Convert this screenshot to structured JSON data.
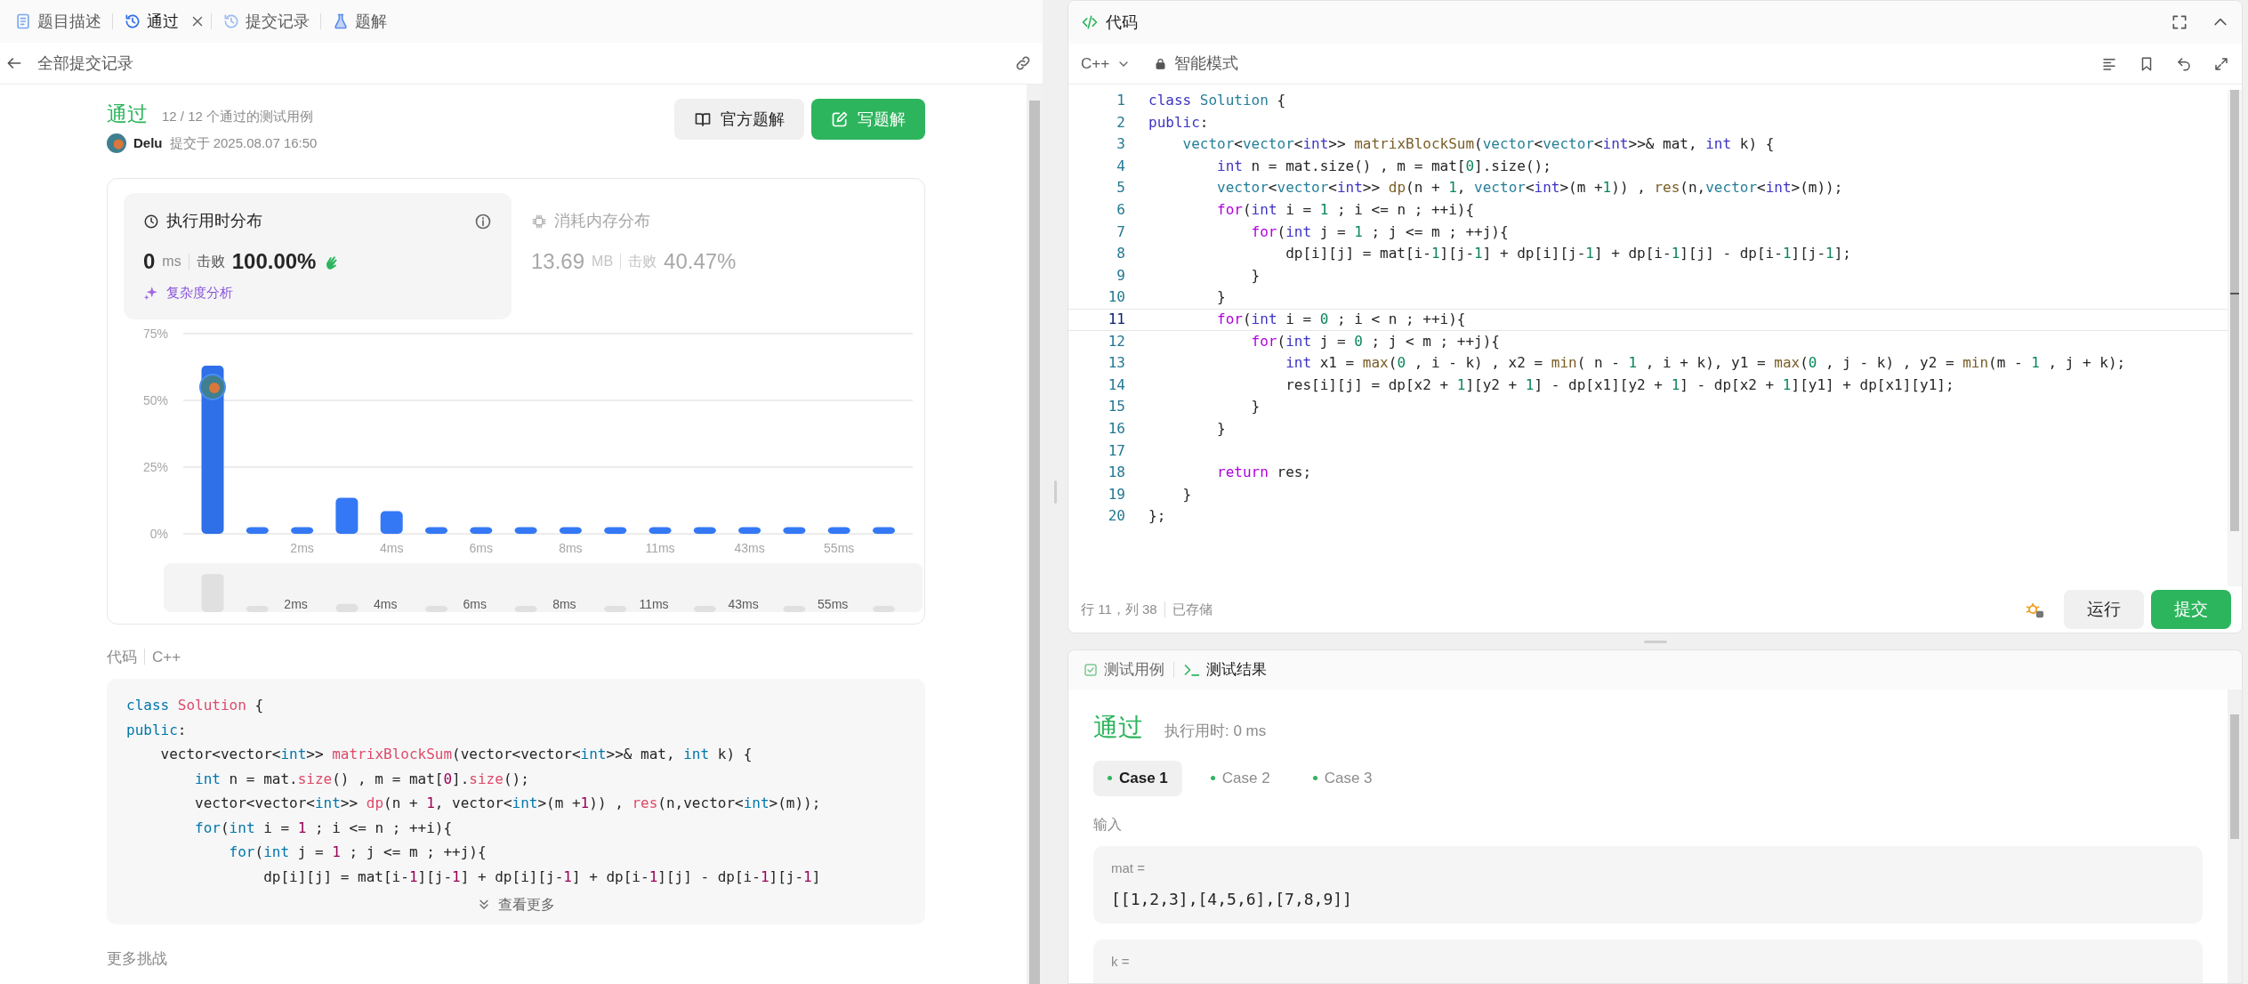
{
  "left_tabs": [
    {
      "label": "题目描述",
      "selected": false,
      "closable": false
    },
    {
      "label": "通过",
      "selected": true,
      "closable": true
    },
    {
      "label": "提交记录",
      "selected": false,
      "closable": false
    },
    {
      "label": "题解",
      "selected": false,
      "closable": false
    }
  ],
  "back_bar": {
    "title": "全部提交记录"
  },
  "submission": {
    "status": "通过",
    "cases": "12 / 12 个通过的测试用例",
    "user": "Delu",
    "submitted": "提交于 2025.08.07 16:50",
    "buttons": [
      {
        "label": "官方题解",
        "kind": "secondary"
      },
      {
        "label": "写题解",
        "kind": "primary"
      }
    ]
  },
  "stats": [
    {
      "title": "执行用时分布",
      "selected": true,
      "value": "0",
      "unit": "ms",
      "beats_label": "击败",
      "beats": "100.00%",
      "link": "复杂度分析"
    },
    {
      "title": "消耗内存分布",
      "selected": false,
      "value": "13.69",
      "unit": "MB",
      "beats_label": "击败",
      "beats": "40.47%"
    }
  ],
  "chart_data": {
    "type": "bar",
    "categories": [
      null,
      null,
      "2ms",
      null,
      "4ms",
      null,
      "6ms",
      null,
      "8ms",
      null,
      "11ms",
      null,
      "43ms",
      null,
      "55ms",
      null
    ],
    "series": [
      {
        "color": "#3478f6",
        "values": [
          63,
          2.5,
          2.5,
          13.5,
          8.5,
          2.5,
          2.5,
          2.5,
          2.5,
          2.5,
          2.5,
          2.5,
          2.5,
          2.5,
          2.5,
          2.5
        ]
      }
    ],
    "ylim": [
      0,
      75
    ],
    "yticks": [
      {
        "value": 0,
        "label": "0%"
      },
      {
        "value": 25,
        "label": "25%"
      },
      {
        "value": 50,
        "label": "50%"
      },
      {
        "value": 75,
        "label": "75%"
      }
    ]
  },
  "navigator": {
    "labels": [
      "2ms",
      "4ms",
      "6ms",
      "8ms",
      "11ms",
      "43ms",
      "55ms"
    ]
  },
  "code_preview": {
    "label": "代码",
    "language": "C++",
    "more": "查看更多",
    "lines": [
      [
        {
          "text": "class",
          "kind": "keyword"
        },
        {
          "text": " Solution",
          "kind": "classname"
        },
        {
          "text": " {",
          "kind": "plain"
        }
      ],
      [
        {
          "text": "public",
          "kind": "keyword"
        },
        {
          "text": ":",
          "kind": "plain"
        }
      ],
      [
        {
          "text": "    vector",
          "kind": "type"
        },
        {
          "text": "<",
          "kind": "plain"
        },
        {
          "text": "vector",
          "kind": "type"
        },
        {
          "text": "<",
          "kind": "plain"
        },
        {
          "text": "int",
          "kind": "keyword"
        },
        {
          "text": ">> ",
          "kind": "plain"
        },
        {
          "text": "matrixBlockSum",
          "kind": "function"
        },
        {
          "text": "(",
          "kind": "plain"
        },
        {
          "text": "vector",
          "kind": "type"
        },
        {
          "text": "<",
          "kind": "plain"
        },
        {
          "text": "vector",
          "kind": "type"
        },
        {
          "text": "<",
          "kind": "plain"
        },
        {
          "text": "int",
          "kind": "keyword"
        },
        {
          "text": ">>& mat, ",
          "kind": "plain"
        },
        {
          "text": "int",
          "kind": "keyword"
        },
        {
          "text": " k) {",
          "kind": "plain"
        }
      ],
      [
        {
          "text": "        int",
          "kind": "keyword"
        },
        {
          "text": " n = mat.",
          "kind": "plain"
        },
        {
          "text": "size",
          "kind": "method"
        },
        {
          "text": "() , m = mat[",
          "kind": "plain"
        },
        {
          "text": "0",
          "kind": "number"
        },
        {
          "text": "].",
          "kind": "plain"
        },
        {
          "text": "size",
          "kind": "method"
        },
        {
          "text": "();",
          "kind": "plain"
        }
      ],
      [
        {
          "text": "        vector",
          "kind": "type"
        },
        {
          "text": "<",
          "kind": "plain"
        },
        {
          "text": "vector",
          "kind": "type"
        },
        {
          "text": "<",
          "kind": "plain"
        },
        {
          "text": "int",
          "kind": "keyword"
        },
        {
          "text": ">> ",
          "kind": "plain"
        },
        {
          "text": "dp",
          "kind": "function"
        },
        {
          "text": "(n + ",
          "kind": "plain"
        },
        {
          "text": "1",
          "kind": "number"
        },
        {
          "text": ", ",
          "kind": "plain"
        },
        {
          "text": "vector",
          "kind": "type"
        },
        {
          "text": "<",
          "kind": "plain"
        },
        {
          "text": "int",
          "kind": "keyword"
        },
        {
          "text": ">(m +",
          "kind": "plain"
        },
        {
          "text": "1",
          "kind": "number"
        },
        {
          "text": ")) , ",
          "kind": "plain"
        },
        {
          "text": "res",
          "kind": "function"
        },
        {
          "text": "(n,",
          "kind": "plain"
        },
        {
          "text": "vector",
          "kind": "type"
        },
        {
          "text": "<",
          "kind": "plain"
        },
        {
          "text": "int",
          "kind": "keyword"
        },
        {
          "text": ">(m));",
          "kind": "plain"
        }
      ],
      [
        {
          "text": "        for",
          "kind": "control"
        },
        {
          "text": "(",
          "kind": "plain"
        },
        {
          "text": "int",
          "kind": "keyword"
        },
        {
          "text": " i = ",
          "kind": "plain"
        },
        {
          "text": "1",
          "kind": "number"
        },
        {
          "text": " ; i <= n ; ++i){",
          "kind": "plain"
        }
      ],
      [
        {
          "text": "            for",
          "kind": "control"
        },
        {
          "text": "(",
          "kind": "plain"
        },
        {
          "text": "int",
          "kind": "keyword"
        },
        {
          "text": " j = ",
          "kind": "plain"
        },
        {
          "text": "1",
          "kind": "number"
        },
        {
          "text": " ; j <= m ; ++j){",
          "kind": "plain"
        }
      ],
      [
        {
          "text": "                dp[i][j] = mat[i-",
          "kind": "plain"
        },
        {
          "text": "1",
          "kind": "number"
        },
        {
          "text": "][j-",
          "kind": "plain"
        },
        {
          "text": "1",
          "kind": "number"
        },
        {
          "text": "] + dp[i][j-",
          "kind": "plain"
        },
        {
          "text": "1",
          "kind": "number"
        },
        {
          "text": "] + dp[i-",
          "kind": "plain"
        },
        {
          "text": "1",
          "kind": "number"
        },
        {
          "text": "][j] - dp[i-",
          "kind": "plain"
        },
        {
          "text": "1",
          "kind": "number"
        },
        {
          "text": "][j-",
          "kind": "plain"
        },
        {
          "text": "1",
          "kind": "number"
        },
        {
          "text": "]",
          "kind": "plain"
        }
      ]
    ]
  },
  "more_title": "更多挑战",
  "editor": {
    "title": "代码",
    "language": "C++",
    "mode": "智能模式",
    "lines": [
      {
        "number": "1",
        "current": false,
        "tokens": [
          {
            "text": "class",
            "kind": "keyword"
          },
          {
            "text": " Solution",
            "kind": "classname"
          },
          {
            "text": " {",
            "kind": "plain"
          }
        ]
      },
      {
        "number": "2",
        "current": false,
        "tokens": [
          {
            "text": "public",
            "kind": "keyword"
          },
          {
            "text": ":",
            "kind": "plain"
          }
        ]
      },
      {
        "number": "3",
        "current": false,
        "tokens": [
          {
            "text": "    vector",
            "kind": "type"
          },
          {
            "text": "<",
            "kind": "plain"
          },
          {
            "text": "vector",
            "kind": "type"
          },
          {
            "text": "<",
            "kind": "plain"
          },
          {
            "text": "int",
            "kind": "keyword"
          },
          {
            "text": ">> ",
            "kind": "plain"
          },
          {
            "text": "matrixBlockSum",
            "kind": "function"
          },
          {
            "text": "(",
            "kind": "plain"
          },
          {
            "text": "vector",
            "kind": "type"
          },
          {
            "text": "<",
            "kind": "plain"
          },
          {
            "text": "vector",
            "kind": "type"
          },
          {
            "text": "<",
            "kind": "plain"
          },
          {
            "text": "int",
            "kind": "keyword"
          },
          {
            "text": ">>& mat, ",
            "kind": "plain"
          },
          {
            "text": "int",
            "kind": "keyword"
          },
          {
            "text": " k) {",
            "kind": "plain"
          }
        ]
      },
      {
        "number": "4",
        "current": false,
        "tokens": [
          {
            "text": "        int",
            "kind": "keyword"
          },
          {
            "text": " n = mat.",
            "kind": "plain"
          },
          {
            "text": "size",
            "kind": "method"
          },
          {
            "text": "() , m = mat[",
            "kind": "plain"
          },
          {
            "text": "0",
            "kind": "number"
          },
          {
            "text": "].",
            "kind": "plain"
          },
          {
            "text": "size",
            "kind": "method"
          },
          {
            "text": "();",
            "kind": "plain"
          }
        ]
      },
      {
        "number": "5",
        "current": false,
        "tokens": [
          {
            "text": "        vector",
            "kind": "type"
          },
          {
            "text": "<",
            "kind": "plain"
          },
          {
            "text": "vector",
            "kind": "type"
          },
          {
            "text": "<",
            "kind": "plain"
          },
          {
            "text": "int",
            "kind": "keyword"
          },
          {
            "text": ">> ",
            "kind": "plain"
          },
          {
            "text": "dp",
            "kind": "function"
          },
          {
            "text": "(n + ",
            "kind": "plain"
          },
          {
            "text": "1",
            "kind": "number"
          },
          {
            "text": ", ",
            "kind": "plain"
          },
          {
            "text": "vector",
            "kind": "type"
          },
          {
            "text": "<",
            "kind": "plain"
          },
          {
            "text": "int",
            "kind": "keyword"
          },
          {
            "text": ">(m +",
            "kind": "plain"
          },
          {
            "text": "1",
            "kind": "number"
          },
          {
            "text": ")) , ",
            "kind": "plain"
          },
          {
            "text": "res",
            "kind": "function"
          },
          {
            "text": "(n,",
            "kind": "plain"
          },
          {
            "text": "vector",
            "kind": "type"
          },
          {
            "text": "<",
            "kind": "plain"
          },
          {
            "text": "int",
            "kind": "keyword"
          },
          {
            "text": ">(m));",
            "kind": "plain"
          }
        ]
      },
      {
        "number": "6",
        "current": false,
        "tokens": [
          {
            "text": "        for",
            "kind": "control"
          },
          {
            "text": "(",
            "kind": "plain"
          },
          {
            "text": "int",
            "kind": "keyword"
          },
          {
            "text": " i = ",
            "kind": "plain"
          },
          {
            "text": "1",
            "kind": "number"
          },
          {
            "text": " ; i <= n ; ++i){",
            "kind": "plain"
          }
        ]
      },
      {
        "number": "7",
        "current": false,
        "tokens": [
          {
            "text": "            for",
            "kind": "control"
          },
          {
            "text": "(",
            "kind": "plain"
          },
          {
            "text": "int",
            "kind": "keyword"
          },
          {
            "text": " j = ",
            "kind": "plain"
          },
          {
            "text": "1",
            "kind": "number"
          },
          {
            "text": " ; j <= m ; ++j){",
            "kind": "plain"
          }
        ]
      },
      {
        "number": "8",
        "current": false,
        "tokens": [
          {
            "text": "                dp[i][j] = mat[i-",
            "kind": "plain"
          },
          {
            "text": "1",
            "kind": "number"
          },
          {
            "text": "][j-",
            "kind": "plain"
          },
          {
            "text": "1",
            "kind": "number"
          },
          {
            "text": "] + dp[i][j-",
            "kind": "plain"
          },
          {
            "text": "1",
            "kind": "number"
          },
          {
            "text": "] + dp[i-",
            "kind": "plain"
          },
          {
            "text": "1",
            "kind": "number"
          },
          {
            "text": "][j] - dp[i-",
            "kind": "plain"
          },
          {
            "text": "1",
            "kind": "number"
          },
          {
            "text": "][j-",
            "kind": "plain"
          },
          {
            "text": "1",
            "kind": "number"
          },
          {
            "text": "];",
            "kind": "plain"
          }
        ]
      },
      {
        "number": "9",
        "current": false,
        "tokens": [
          {
            "text": "            }",
            "kind": "plain"
          }
        ]
      },
      {
        "number": "10",
        "current": false,
        "tokens": [
          {
            "text": "        }",
            "kind": "plain"
          }
        ]
      },
      {
        "number": "11",
        "current": true,
        "tokens": [
          {
            "text": "        for",
            "kind": "control"
          },
          {
            "text": "(",
            "kind": "plain"
          },
          {
            "text": "int",
            "kind": "keyword"
          },
          {
            "text": " i = ",
            "kind": "plain"
          },
          {
            "text": "0",
            "kind": "number"
          },
          {
            "text": " ; i < n ; ++i){",
            "kind": "plain"
          }
        ]
      },
      {
        "number": "12",
        "current": false,
        "tokens": [
          {
            "text": "            for",
            "kind": "control"
          },
          {
            "text": "(",
            "kind": "plain"
          },
          {
            "text": "int",
            "kind": "keyword"
          },
          {
            "text": " j = ",
            "kind": "plain"
          },
          {
            "text": "0",
            "kind": "number"
          },
          {
            "text": " ; j < m ; ++j){",
            "kind": "plain"
          }
        ]
      },
      {
        "number": "13",
        "current": false,
        "tokens": [
          {
            "text": "                int",
            "kind": "keyword"
          },
          {
            "text": " x1 = ",
            "kind": "plain"
          },
          {
            "text": "max",
            "kind": "function"
          },
          {
            "text": "(",
            "kind": "plain"
          },
          {
            "text": "0",
            "kind": "number"
          },
          {
            "text": " , i - k) , x2 = ",
            "kind": "plain"
          },
          {
            "text": "min",
            "kind": "function"
          },
          {
            "text": "( n - ",
            "kind": "plain"
          },
          {
            "text": "1",
            "kind": "number"
          },
          {
            "text": " , i + k), y1 = ",
            "kind": "plain"
          },
          {
            "text": "max",
            "kind": "function"
          },
          {
            "text": "(",
            "kind": "plain"
          },
          {
            "text": "0",
            "kind": "number"
          },
          {
            "text": " , j - k) , y2 = ",
            "kind": "plain"
          },
          {
            "text": "min",
            "kind": "function"
          },
          {
            "text": "(m - ",
            "kind": "plain"
          },
          {
            "text": "1",
            "kind": "number"
          },
          {
            "text": " , j + k);",
            "kind": "plain"
          }
        ]
      },
      {
        "number": "14",
        "current": false,
        "tokens": [
          {
            "text": "                res[i][j] = dp[x2 + ",
            "kind": "plain"
          },
          {
            "text": "1",
            "kind": "number"
          },
          {
            "text": "][y2 + ",
            "kind": "plain"
          },
          {
            "text": "1",
            "kind": "number"
          },
          {
            "text": "] - dp[x1][y2 + ",
            "kind": "plain"
          },
          {
            "text": "1",
            "kind": "number"
          },
          {
            "text": "] - dp[x2 + ",
            "kind": "plain"
          },
          {
            "text": "1",
            "kind": "number"
          },
          {
            "text": "][y1] + dp[x1][y1];",
            "kind": "plain"
          }
        ]
      },
      {
        "number": "15",
        "current": false,
        "tokens": [
          {
            "text": "            }",
            "kind": "plain"
          }
        ]
      },
      {
        "number": "16",
        "current": false,
        "tokens": [
          {
            "text": "        }",
            "kind": "plain"
          }
        ]
      },
      {
        "number": "17",
        "current": false
      },
      {
        "number": "18",
        "current": false,
        "tokens": [
          {
            "text": "        return",
            "kind": "control"
          },
          {
            "text": " res;",
            "kind": "plain"
          }
        ]
      },
      {
        "number": "19",
        "current": false,
        "tokens": [
          {
            "text": "    }",
            "kind": "plain"
          }
        ]
      },
      {
        "number": "20",
        "current": false,
        "tokens": [
          {
            "text": "};",
            "kind": "plain"
          }
        ]
      }
    ],
    "position": "行 11，列 38",
    "saved": "已存储",
    "buttons": [
      {
        "label": "运行",
        "kind": "secondary"
      },
      {
        "label": "提交",
        "kind": "primary"
      }
    ]
  },
  "results": {
    "tabs": [
      {
        "label": "测试用例",
        "selected": false
      },
      {
        "label": "测试结果",
        "selected": true
      }
    ],
    "status": "通过",
    "runtime": "执行用时: 0 ms",
    "cases": [
      {
        "label": "Case 1",
        "selected": true
      },
      {
        "label": "Case 2",
        "selected": false
      },
      {
        "label": "Case 3",
        "selected": false
      }
    ],
    "input_label": "输入",
    "inputs": [
      {
        "name": "mat =",
        "value": "[[1,2,3],[4,5,6],[7,8,9]]"
      },
      {
        "name": "k ="
      }
    ]
  }
}
